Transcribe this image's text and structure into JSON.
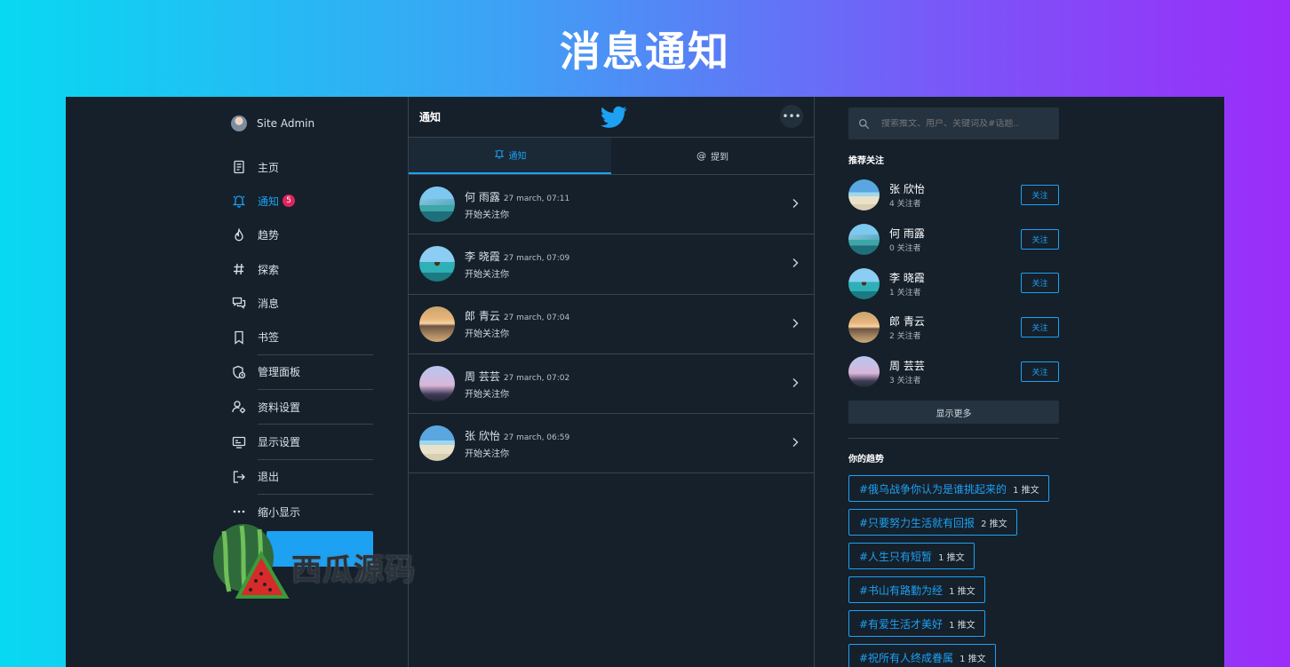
{
  "banner": {
    "title": "消息通知"
  },
  "nav": {
    "user": "Site Admin",
    "items": [
      {
        "label": "主页",
        "icon": "document-icon"
      },
      {
        "label": "通知",
        "icon": "bell-icon",
        "badge": "5",
        "active": true
      },
      {
        "label": "趋势",
        "icon": "flame-icon"
      },
      {
        "label": "探索",
        "icon": "hashtag-icon"
      },
      {
        "label": "消息",
        "icon": "messages-icon"
      },
      {
        "label": "书签",
        "icon": "bookmark-icon"
      },
      {
        "label": "管理面板",
        "icon": "admin-shield-icon"
      },
      {
        "label": "资料设置",
        "icon": "user-gear-icon"
      },
      {
        "label": "显示设置",
        "icon": "display-icon"
      },
      {
        "label": "退出",
        "icon": "logout-icon"
      },
      {
        "label": "缩小显示",
        "icon": "more-dots-icon"
      }
    ]
  },
  "watermark": {
    "text": "西瓜源码"
  },
  "main": {
    "title": "通知",
    "tabs": [
      {
        "label": "通知",
        "icon": "bell-icon",
        "active": true
      },
      {
        "label": "提到",
        "icon": "at-icon",
        "active": false
      }
    ],
    "notifications": [
      {
        "name": "何 雨露",
        "time": "27 march, 07:11",
        "text": "开始关注你",
        "avatar": "av-bridge"
      },
      {
        "name": "李 晓霞",
        "time": "27 march, 07:09",
        "text": "开始关注你",
        "avatar": "av-hut"
      },
      {
        "name": "郎 青云",
        "time": "27 march, 07:04",
        "text": "开始关注你",
        "avatar": "av-sunset"
      },
      {
        "name": "周 芸芸",
        "time": "27 march, 07:02",
        "text": "开始关注你",
        "avatar": "av-temple"
      },
      {
        "name": "张 欣怡",
        "time": "27 march, 06:59",
        "text": "开始关注你",
        "avatar": "av-beach"
      }
    ]
  },
  "sidebar": {
    "search_placeholder": "搜索推文、用户、关键词及#话题..",
    "suggestions_title": "推荐关注",
    "suggestions": [
      {
        "name": "张 欣怡",
        "count": "4 关注者",
        "button": "关注",
        "avatar": "av-beach"
      },
      {
        "name": "何 雨露",
        "count": "0 关注者",
        "button": "关注",
        "avatar": "av-bridge"
      },
      {
        "name": "李 晓霞",
        "count": "1 关注者",
        "button": "关注",
        "avatar": "av-hut"
      },
      {
        "name": "郎 青云",
        "count": "2 关注者",
        "button": "关注",
        "avatar": "av-sunset"
      },
      {
        "name": "周 芸芸",
        "count": "3 关注者",
        "button": "关注",
        "avatar": "av-temple"
      }
    ],
    "show_more": "显示更多",
    "trends_title": "你的趋势",
    "trends": [
      {
        "tag": "#俄乌战争你认为是谁挑起来的",
        "count": "1 推文"
      },
      {
        "tag": "#只要努力生活就有回报",
        "count": "2 推文"
      },
      {
        "tag": "#人生只有短暂",
        "count": "1 推文"
      },
      {
        "tag": "#书山有路勤为经",
        "count": "1 推文"
      },
      {
        "tag": "#有爱生活才美好",
        "count": "1 推文"
      },
      {
        "tag": "#祝所有人终成眷属",
        "count": "1 推文"
      }
    ]
  },
  "colors": {
    "accent": "#1da1f2",
    "background": "#15202b",
    "badge": "#e0245e"
  }
}
